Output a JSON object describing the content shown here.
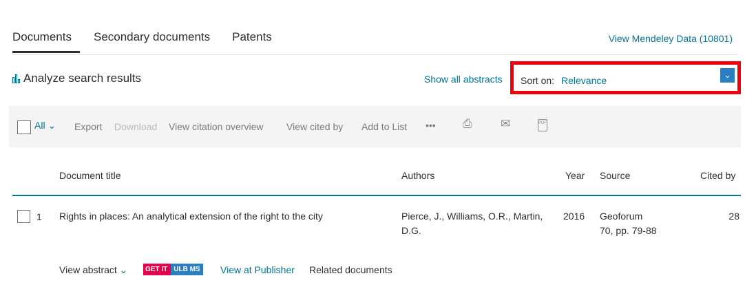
{
  "tabs": [
    {
      "label": "Documents",
      "active": true
    },
    {
      "label": "Secondary documents",
      "active": false
    },
    {
      "label": "Patents",
      "active": false
    }
  ],
  "mendeley_link": "View Mendeley Data (10801)",
  "analyze_label": "Analyze search results",
  "show_abstracts": "Show all abstracts",
  "sort": {
    "label": "Sort on:",
    "value": "Relevance",
    "highlight_color": "#f0000f"
  },
  "toolbar": {
    "all_label": "All",
    "export": "Export",
    "download": "Download",
    "view_citation_overview": "View citation overview",
    "view_cited_by": "View cited by",
    "add_to_list": "Add to List",
    "more": "•••"
  },
  "table": {
    "headers": {
      "title": "Document title",
      "authors": "Authors",
      "year": "Year",
      "source": "Source",
      "cited_by": "Cited by"
    },
    "rows": [
      {
        "number": "1",
        "title": "Rights in places: An analytical extension of the right to the city",
        "authors_line1": "Pierce, J., Williams, O.R., Martin,",
        "authors_line2": "D.G.",
        "year": "2016",
        "source_line1": "Geoforum",
        "source_line2": "70, pp. 79-88",
        "cited_by": "28",
        "actions": {
          "view_abstract": "View abstract",
          "getit_part1": "GET IT",
          "getit_part2": "ULB MS",
          "view_at_publisher": "View at Publisher",
          "related_documents": "Related documents"
        }
      }
    ]
  },
  "colors": {
    "link": "#007398",
    "accent_line": "#007398",
    "toolbar_bg": "#f4f4f4",
    "sort_button": "#2b7fc1"
  }
}
